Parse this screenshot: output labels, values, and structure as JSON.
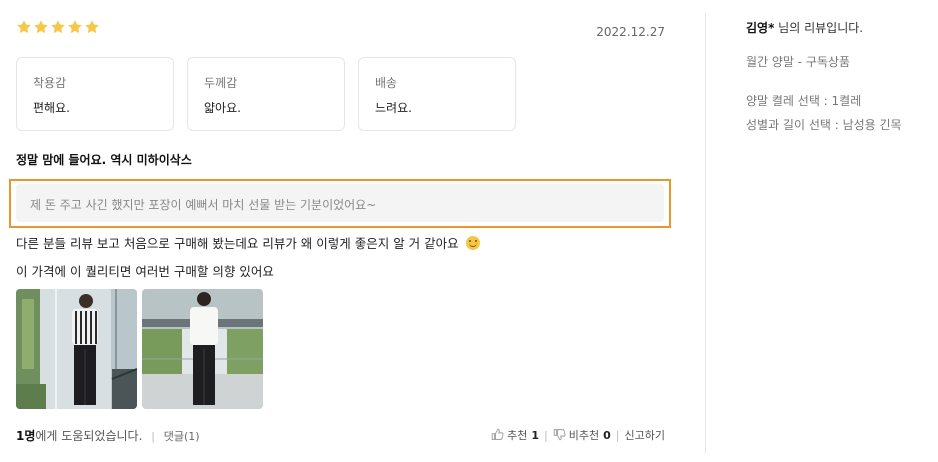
{
  "review": {
    "rating": 5,
    "date": "2022.12.27",
    "attributes": [
      {
        "label": "착용감",
        "value": "편해요."
      },
      {
        "label": "두께감",
        "value": "얇아요."
      },
      {
        "label": "배송",
        "value": "느려요."
      }
    ],
    "title": "정말 맘에 들어요. 역시 미하이삭스",
    "highlighted_text": "제 돈 주고 사긴 했지만 포장이 예뻐서 마치 선물 받는 기분이었어요~",
    "body_line1": "다른 분들 리뷰 보고 처음으로 구매해 봤는데요 리뷰가 왜 이렇게 좋은지 알 거 같아요",
    "body_line2": "이 가격에 이 퀄리티면 여러번 구매할 의향 있어요",
    "helpful_count": "1명",
    "helpful_suffix": "에게 도움되었습니다.",
    "comment_label": "댓글(1)",
    "recommend_label": "추천",
    "recommend_count": "1",
    "not_recommend_label": "비추천",
    "not_recommend_count": "0",
    "report_label": "신고하기"
  },
  "sidebar": {
    "reviewer_name": "김영*",
    "reviewer_suffix": " 님의 리뷰입니다.",
    "product": "월간 양말 - 구독상품",
    "option1": "양말 켤레 선택 : 1켤레",
    "option2": "성별과 길이 선택 : 남성용 긴목"
  },
  "colors": {
    "star": "#f5c84a",
    "highlight_border": "#e8962f"
  },
  "icons": [
    "star-icon",
    "smile-emoji-icon",
    "thumbs-up-icon",
    "thumbs-down-icon"
  ]
}
